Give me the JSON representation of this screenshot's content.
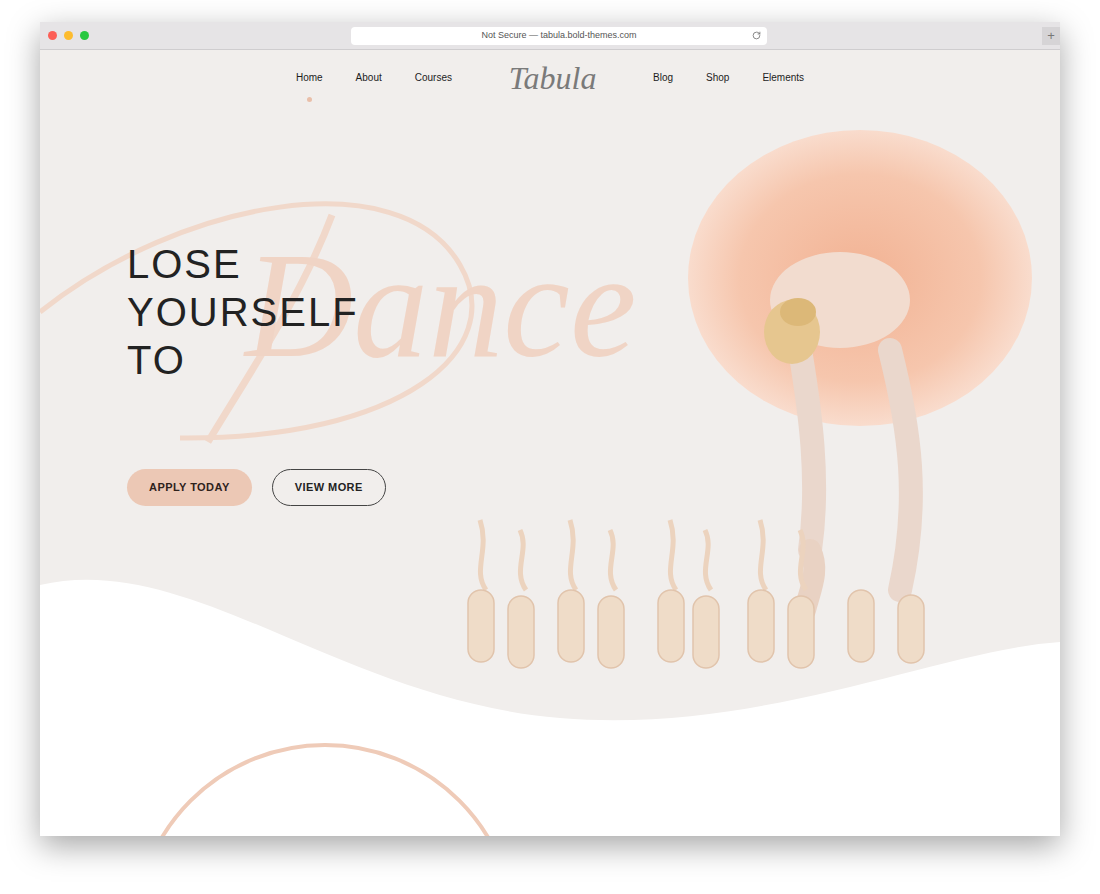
{
  "browser": {
    "address": "Not Secure — tabula.bold-themes.com",
    "new_tab": "+"
  },
  "nav": {
    "left": [
      {
        "label": "Home",
        "selected": true
      },
      {
        "label": "About",
        "selected": false
      },
      {
        "label": "Courses",
        "selected": false
      }
    ],
    "logo": "Tabula",
    "right": [
      {
        "label": "Blog",
        "selected": false
      },
      {
        "label": "Shop",
        "selected": false
      },
      {
        "label": "Elements",
        "selected": false
      }
    ]
  },
  "hero": {
    "heading": [
      "LOSE",
      "YOURSELF",
      "TO"
    ],
    "watermark": "Dance",
    "buttons": [
      {
        "label": "APPLY TODAY",
        "kind": "filled"
      },
      {
        "label": "VIEW MORE",
        "kind": "outline"
      }
    ]
  }
}
